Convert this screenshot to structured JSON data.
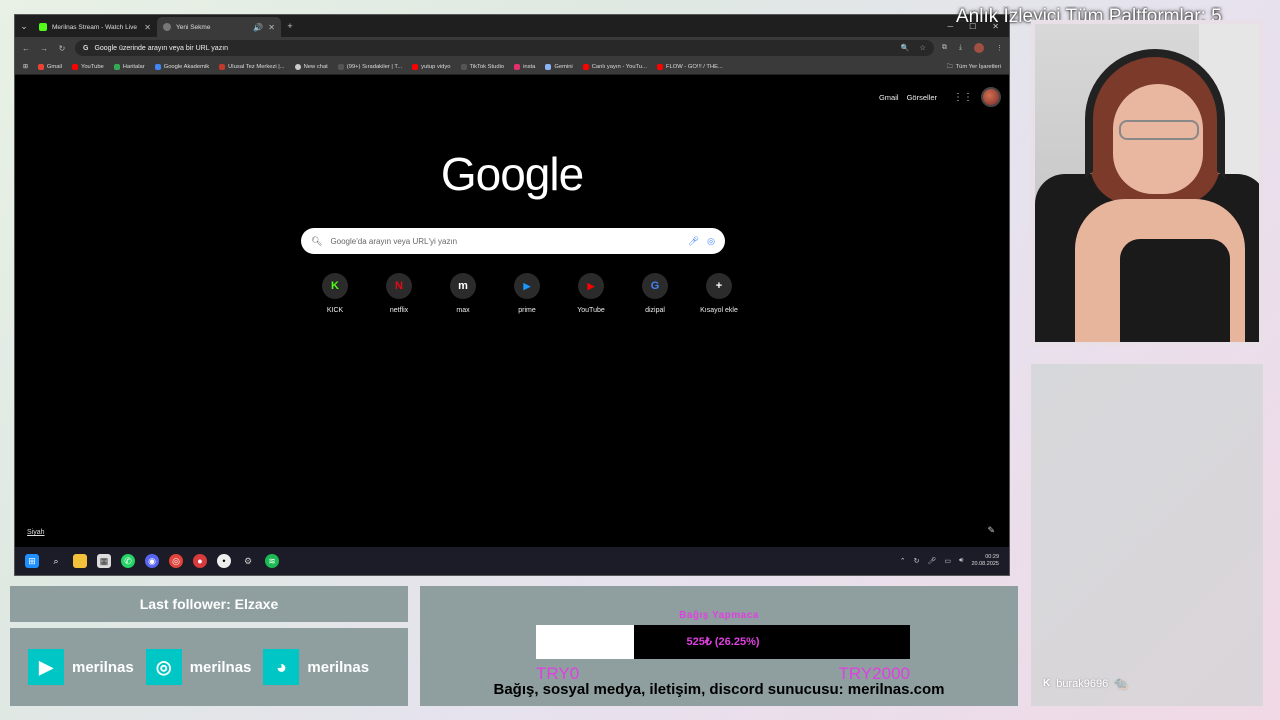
{
  "tabs": [
    {
      "label": "Merilnas Stream - Watch Live o",
      "color": "#53fc18",
      "active": false
    },
    {
      "label": "Yeni Sekme",
      "color": "#777777",
      "active": true
    }
  ],
  "omnibox": {
    "url_text": "Google üzerinde arayın veya bir URL yazın"
  },
  "bookmarks": [
    {
      "label": "Gmail",
      "color": "#ea4335"
    },
    {
      "label": "YouTube",
      "color": "#ff0000"
    },
    {
      "label": "Haritalar",
      "color": "#34a853"
    },
    {
      "label": "Google Akademik",
      "color": "#4285f4"
    },
    {
      "label": "Ulusal Tez Merkezi |...",
      "color": "#c0392b"
    },
    {
      "label": "New chat",
      "color": "#cccccc"
    },
    {
      "label": "(99+) Sıradakiler | T...",
      "color": "#000000"
    },
    {
      "label": "yutup vidyo",
      "color": "#ff0000"
    },
    {
      "label": "TikTok Studio",
      "color": "#000000"
    },
    {
      "label": "insta",
      "color": "#e1306c"
    },
    {
      "label": "Gemini",
      "color": "#8ab4f8"
    },
    {
      "label": "Canlı yayın - YouTu...",
      "color": "#ff0000"
    },
    {
      "label": "FLOW - GO!!! / THE...",
      "color": "#ff0000"
    }
  ],
  "all_bookmarks": "Tüm Yer İşaretleri",
  "google": {
    "top_links": [
      "Gmail",
      "Görseller"
    ],
    "logo": "Google",
    "search_placeholder": "Google'da arayın veya URL'yi yazın",
    "shortcuts": [
      {
        "label": "KICK",
        "glyph": "K",
        "color": "#53fc18"
      },
      {
        "label": "netflix",
        "glyph": "N",
        "color": "#e50914"
      },
      {
        "label": "max",
        "glyph": "m",
        "color": "#ffffff"
      },
      {
        "label": "prime",
        "glyph": "▶",
        "color": "#1a98ff"
      },
      {
        "label": "YouTube",
        "glyph": "▶",
        "color": "#ff0000"
      },
      {
        "label": "dizipal",
        "glyph": "G",
        "color": "#4285f4"
      },
      {
        "label": "Kısayol ekle",
        "glyph": "+",
        "color": "#ffffff"
      }
    ],
    "theme_label": "Siyah"
  },
  "taskbar": {
    "time": "00:29",
    "date": "20.08.2025"
  },
  "overlay": {
    "viewers_title": "Anlık İzleyici Tüm Paltformlar: 5",
    "last_follower": "Last follower: Elzaxe",
    "socials": [
      {
        "platform": "youtube-icon",
        "label": "merilnas",
        "color": "#00c6c6"
      },
      {
        "platform": "instagram-icon",
        "label": "merilnas",
        "color": "#00c6c6"
      },
      {
        "platform": "discord-icon",
        "label": "merilnas",
        "color": "#00c6c6"
      }
    ],
    "chat_user": "burak9696"
  },
  "donation": {
    "title": "Bağış Yapmaca",
    "progress_text": "525₺ (26.25%)",
    "progress_fraction": 0.2625,
    "min_label": "TRY0",
    "max_label": "TRY2000",
    "info": "Bağış, sosyal medya, iletişim, discord sunucusu: merilnas.com"
  }
}
